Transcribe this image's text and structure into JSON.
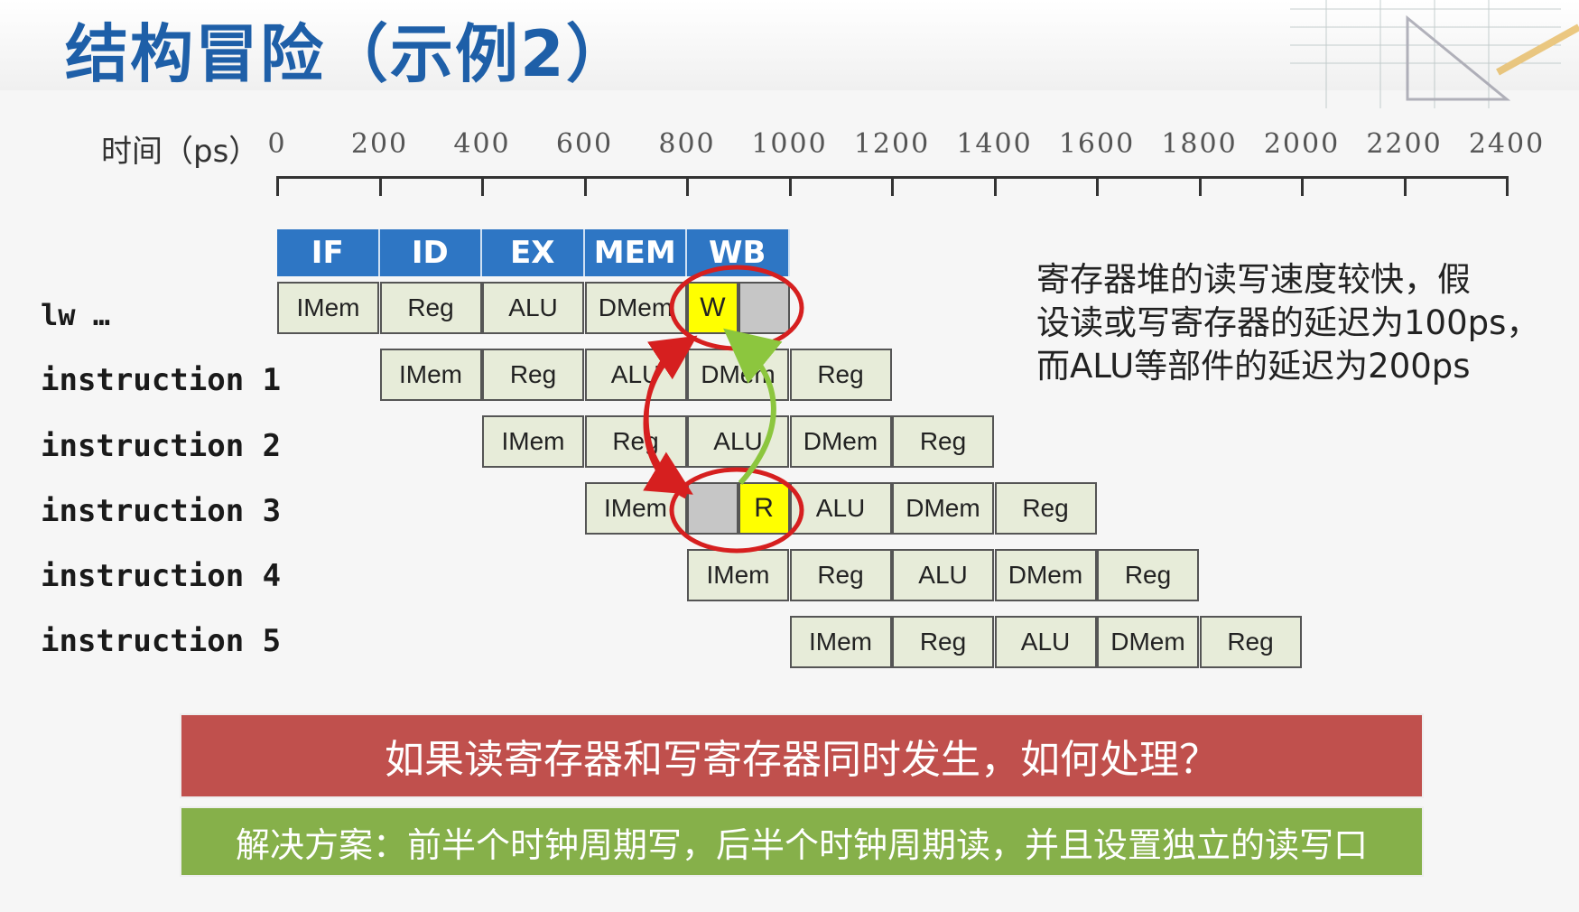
{
  "title": "结构冒险（示例2）",
  "axis": {
    "label": "时间（ps）",
    "ticks": [
      "0",
      "200",
      "400",
      "600",
      "800",
      "1000",
      "1200",
      "1400",
      "1600",
      "1800",
      "2000",
      "2200",
      "2400"
    ]
  },
  "stage_headers": [
    "IF",
    "ID",
    "EX",
    "MEM",
    "WB"
  ],
  "rows": [
    {
      "label": "lw …",
      "start": 0,
      "stages": [
        "IMem",
        "Reg",
        "ALU",
        "DMem"
      ],
      "last": "W"
    },
    {
      "label": "instruction 1",
      "start": 1,
      "stages": [
        "IMem",
        "Reg",
        "ALU",
        "DMem",
        "Reg"
      ]
    },
    {
      "label": "instruction 2",
      "start": 2,
      "stages": [
        "IMem",
        "Reg",
        "ALU",
        "DMem",
        "Reg"
      ]
    },
    {
      "label": "instruction 3",
      "start": 3,
      "stages": [
        "IMem"
      ],
      "read": "R",
      "rest": [
        "ALU",
        "DMem",
        "Reg"
      ]
    },
    {
      "label": "instruction 4",
      "start": 4,
      "stages": [
        "IMem",
        "Reg",
        "ALU",
        "DMem",
        "Reg"
      ]
    },
    {
      "label": "instruction 5",
      "start": 5,
      "stages": [
        "IMem",
        "Reg",
        "ALU",
        "DMem",
        "Reg"
      ]
    }
  ],
  "note": {
    "line1": "寄存器堆的读写速度较快，假",
    "line2": "设读或写寄存器的延迟为100ps，",
    "line3": "而ALU等部件的延迟为200ps"
  },
  "question": "如果读寄存器和写寄存器同时发生，如何处理？",
  "solution": "解决方案：前半个时钟周期写，后半个时钟周期读，并且设置独立的读写口",
  "colors": {
    "header": "#2e76c4",
    "cell": "#e7ecd9",
    "highlight_yellow": "#ffff00",
    "highlight_grey": "#c6c6c6",
    "circle_red": "#d61f1f",
    "arrow_green": "#8cc63e",
    "question_bg": "#c0504d",
    "solution_bg": "#86b04a",
    "title": "#1e5fa8"
  }
}
